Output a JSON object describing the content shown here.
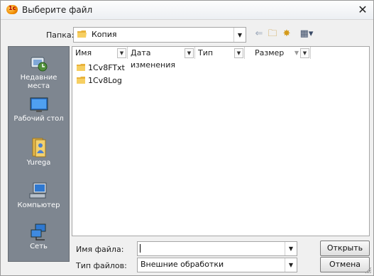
{
  "window": {
    "title": "Выберите файл"
  },
  "toolbar": {
    "lookin_label": "Папка:",
    "lookin_value": "Копия",
    "back_glyph": "⇐",
    "up_glyph": "🗀",
    "newfolder_glyph": "✸",
    "views_glyph": "▦▾"
  },
  "places": [
    {
      "label": "Недавние\nместа",
      "icon": "recent-places-icon"
    },
    {
      "label": "Рабочий стол",
      "icon": "desktop-icon"
    },
    {
      "label": "Yurega",
      "icon": "user-folder-icon"
    },
    {
      "label": "Компьютер",
      "icon": "computer-icon"
    },
    {
      "label": "Сеть",
      "icon": "network-icon"
    }
  ],
  "columns": [
    "Имя",
    "Дата изменения",
    "Тип",
    "Размер"
  ],
  "files": [
    {
      "name": "1Cv8FTxt",
      "kind": "folder"
    },
    {
      "name": "1Cv8Log",
      "kind": "folder"
    }
  ],
  "filename": {
    "label": "Имя файла:",
    "value": ""
  },
  "filetype": {
    "label": "Тип файлов:",
    "value": "Внешние обработки"
  },
  "buttons": {
    "open": "Открыть",
    "cancel": "Отмена"
  }
}
